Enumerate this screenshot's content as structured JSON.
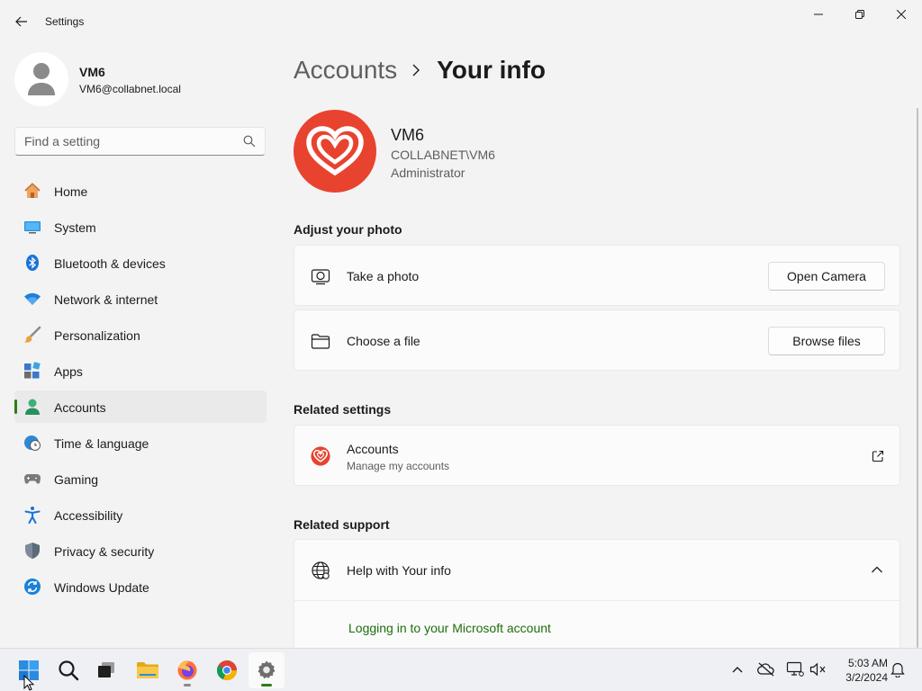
{
  "window": {
    "title": "Settings"
  },
  "profile": {
    "name": "VM6",
    "email": "VM6@collabnet.local"
  },
  "search": {
    "placeholder": "Find a setting"
  },
  "nav": {
    "items": [
      {
        "label": "Home",
        "icon": "home-icon"
      },
      {
        "label": "System",
        "icon": "system-icon"
      },
      {
        "label": "Bluetooth & devices",
        "icon": "bluetooth-icon"
      },
      {
        "label": "Network & internet",
        "icon": "wifi-icon"
      },
      {
        "label": "Personalization",
        "icon": "brush-icon"
      },
      {
        "label": "Apps",
        "icon": "apps-icon"
      },
      {
        "label": "Accounts",
        "icon": "accounts-icon",
        "active": true
      },
      {
        "label": "Time & language",
        "icon": "clock-globe-icon"
      },
      {
        "label": "Gaming",
        "icon": "gamepad-icon"
      },
      {
        "label": "Accessibility",
        "icon": "accessibility-icon"
      },
      {
        "label": "Privacy & security",
        "icon": "shield-icon"
      },
      {
        "label": "Windows Update",
        "icon": "update-icon"
      }
    ]
  },
  "breadcrumb": {
    "parent": "Accounts",
    "current": "Your info"
  },
  "user": {
    "name": "VM6",
    "domain": "COLLABNET\\VM6",
    "role": "Administrator"
  },
  "adjust_photo": {
    "title": "Adjust your photo",
    "take_photo": {
      "label": "Take a photo",
      "button": "Open Camera"
    },
    "choose_file": {
      "label": "Choose a file",
      "button": "Browse files"
    }
  },
  "related_settings": {
    "title": "Related settings",
    "accounts": {
      "label": "Accounts",
      "sublabel": "Manage my accounts"
    }
  },
  "related_support": {
    "title": "Related support",
    "help": {
      "label": "Help with Your info",
      "link": "Logging in to your Microsoft account"
    }
  },
  "taskbar": {
    "apps": [
      "start-icon",
      "search-icon",
      "task-view-icon",
      "file-explorer-icon",
      "firefox-icon",
      "chrome-icon",
      "settings-icon"
    ],
    "time": "5:03 AM",
    "date": "3/2/2024"
  },
  "colors": {
    "accent": "#2b7d16",
    "avatar": "#e8432f",
    "link": "#1f6e0c"
  }
}
